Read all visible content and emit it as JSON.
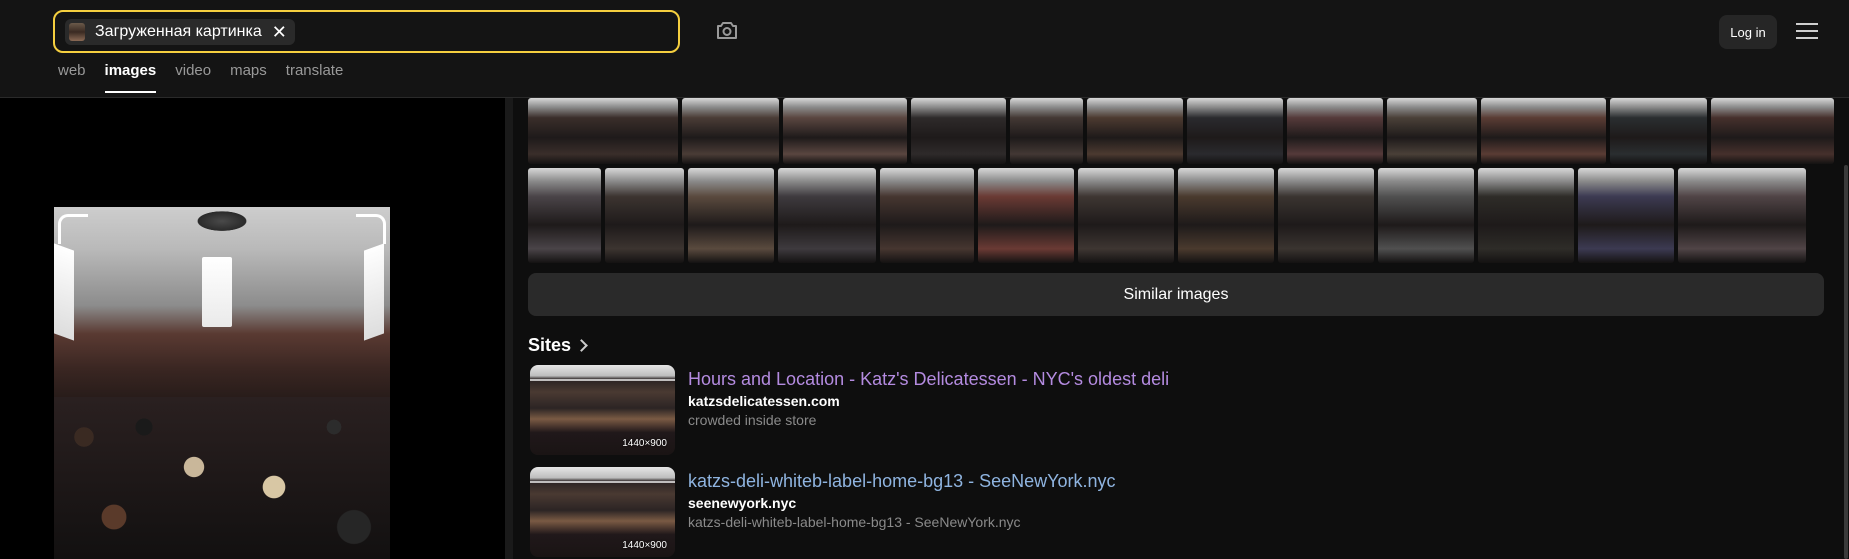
{
  "search": {
    "chip_label": "Загруженная картинка",
    "close_glyph": "✕",
    "camera_icon": "camera-search-icon"
  },
  "header": {
    "login_label": "Log in",
    "menu_icon": "hamburger-menu-icon"
  },
  "tabs": [
    {
      "label": "web",
      "active": false
    },
    {
      "label": "images",
      "active": true
    },
    {
      "label": "video",
      "active": false
    },
    {
      "label": "maps",
      "active": false
    },
    {
      "label": "translate",
      "active": false
    }
  ],
  "similar_images": {
    "row1_colors": [
      "#3a2e2a",
      "#4a3c36",
      "#5a4640",
      "#2e2a2a",
      "#433834",
      "#4c3a30",
      "#2a2a2e",
      "#553a3a",
      "#4a4038",
      "#5a3c34",
      "#2a2e30",
      "#46302c"
    ],
    "row2_colors": [
      "#4a4448",
      "#3c3430",
      "#5a4a3e",
      "#3e3a3e",
      "#463630",
      "#6a3a34",
      "#3e3632",
      "#4a3a2e",
      "#3a3430",
      "#505050",
      "#2e2c28",
      "#3c3a52",
      "#504446"
    ],
    "button_label": "Similar images"
  },
  "sites": {
    "title": "Sites",
    "results": [
      {
        "title": "Hours and Location - Katz's Delicatessen - NYC's oldest deli",
        "domain": "katzsdelicatessen.com",
        "description": "crowded inside store",
        "dims": "1440×900",
        "title_color": "#b48be0"
      },
      {
        "title": "katzs-deli-whiteb-label-home-bg13 - SeeNewYork.nyc",
        "domain": "seenewyork.nyc",
        "description": "katzs-deli-whiteb-label-home-bg13 - SeeNewYork.nyc",
        "dims": "1440×900",
        "title_color": "#8fb4e0"
      }
    ]
  },
  "colors": {
    "accent_search_border": "#f5cf3f",
    "background": "#0e0e0e"
  }
}
